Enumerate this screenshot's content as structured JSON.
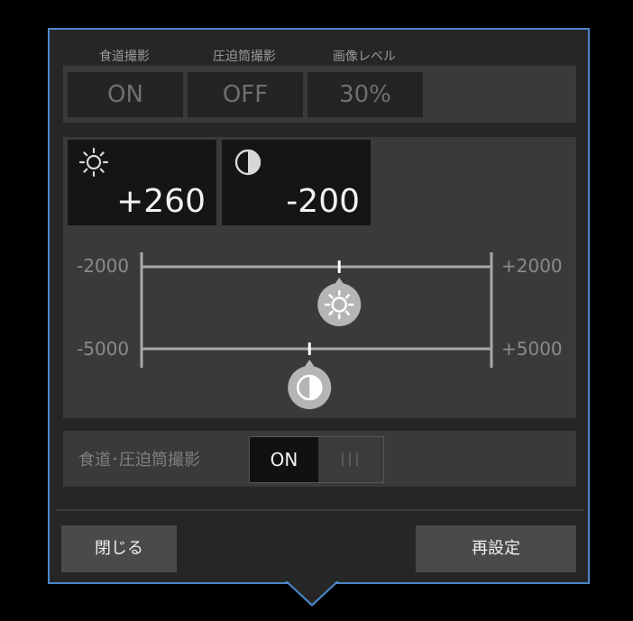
{
  "header": {
    "labels": [
      "食道撮影",
      "圧迫筒撮影",
      "画像レベル"
    ],
    "values": [
      "ON",
      "OFF",
      "30%"
    ]
  },
  "adjust": {
    "brightness": {
      "icon": "brightness-icon",
      "value": "+260"
    },
    "contrast": {
      "icon": "contrast-icon",
      "value": "-200"
    },
    "brightness_scale": {
      "min": "-2000",
      "max": "+2000",
      "level": 260
    },
    "contrast_scale": {
      "min": "-5000",
      "max": "+5000",
      "level": -200
    }
  },
  "toggle": {
    "label": "食道･圧迫筒撮影",
    "on_label": "ON",
    "off_label": "III"
  },
  "footer": {
    "close_label": "閉じる",
    "reset_label": "再設定"
  },
  "colors": {
    "accent_border": "#4a86c8",
    "panel_bg": "#262626"
  }
}
